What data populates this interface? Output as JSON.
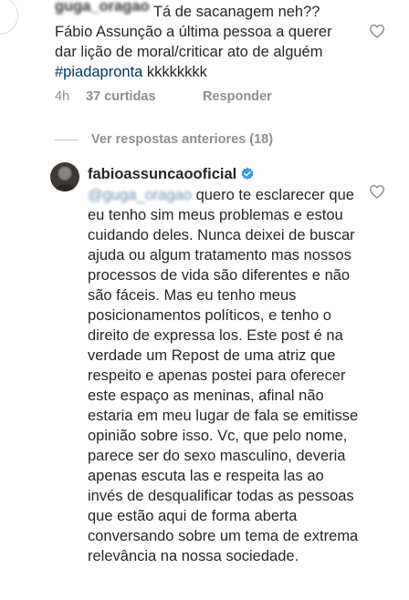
{
  "comment1": {
    "username": "guga_oragao",
    "text_part1": "Tá de sacanagem neh?? Fábio Assunção a última pessoa a querer dar lição de moral/criticar ato de alguém ",
    "hashtag": "#piadapronta",
    "text_part2": " kkkkkkkk",
    "time": "4h",
    "likes": "37 curtidas",
    "reply_label": "Responder"
  },
  "view_replies": {
    "label": "Ver respostas anteriores (18)"
  },
  "comment2": {
    "username": "fabioassuncaooficial",
    "mention": "@guga_oragao",
    "body": " quero te esclarecer que eu tenho sim meus problemas e estou cuidando deles. Nunca deixei de buscar ajuda ou algum tratamento mas nossos processos de vida são diferentes e não são fáceis. Mas eu tenho meus posicionamentos políticos, e tenho o direito de expressa los. Este post é na verdade um Repost de uma atriz que respeito e apenas postei para oferecer este espaço as meninas, afinal não estaria em meu lugar de fala se emitisse opinião sobre isso. Vc, que pelo nome, parece ser do sexo masculino, deveria apenas escuta las e respeita las ao invés de desqualificar todas as pessoas que estão aqui de forma aberta conversando sobre um tema de extrema relevância na nossa sociedade."
  },
  "icons": {
    "like_heart": "heart-outline-icon",
    "verified": "verified-badge-icon",
    "verified_color": "#3897f0",
    "link_color": "#00376b",
    "meta_color": "#8e8e8e"
  }
}
